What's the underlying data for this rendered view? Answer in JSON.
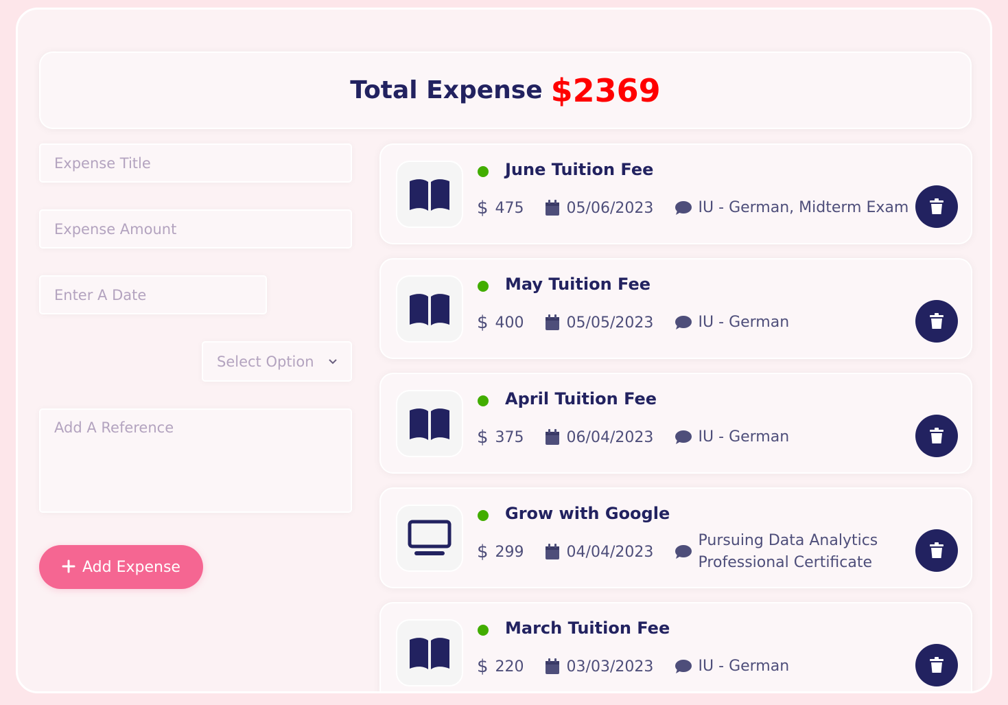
{
  "header": {
    "label": "Total Expense",
    "amount": "$2369"
  },
  "form": {
    "title_placeholder": "Expense Title",
    "amount_placeholder": "Expense Amount",
    "date_placeholder": "Enter A Date",
    "select_value": "Select Option",
    "reference_placeholder": "Add A Reference",
    "add_button_label": "Add Expense"
  },
  "colors": {
    "accent": "#f56692",
    "primary": "#222260",
    "total": "#ff0000",
    "status": "#42ad00"
  },
  "expenses": [
    {
      "title": "June Tuition Fee",
      "currency": "$",
      "amount": "475",
      "date": "05/06/2023",
      "reference": "IU - German, Midterm Exam",
      "icon": "book-icon"
    },
    {
      "title": "May Tuition Fee",
      "currency": "$",
      "amount": "400",
      "date": "05/05/2023",
      "reference": "IU - German",
      "icon": "book-icon"
    },
    {
      "title": "April Tuition Fee",
      "currency": "$",
      "amount": "375",
      "date": "06/04/2023",
      "reference": "IU - German",
      "icon": "book-icon"
    },
    {
      "title": "Grow with Google",
      "currency": "$",
      "amount": "299",
      "date": "04/04/2023",
      "reference": "Pursuing Data Analytics Professional Certificate",
      "icon": "laptop-icon"
    },
    {
      "title": "March Tuition Fee",
      "currency": "$",
      "amount": "220",
      "date": "03/03/2023",
      "reference": "IU - German",
      "icon": "book-icon"
    }
  ]
}
